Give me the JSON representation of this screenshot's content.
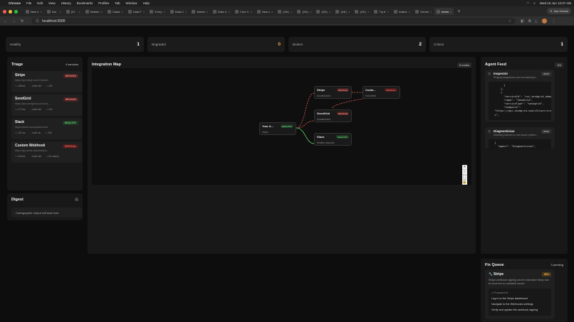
{
  "menubar": {
    "app": "Chrome",
    "items": [
      "File",
      "Edit",
      "View",
      "History",
      "Bookmarks",
      "Profiles",
      "Tab",
      "Window",
      "Help"
    ],
    "clock": "Wed 10 Jun 12:07 AM"
  },
  "tabs": [
    {
      "label": "New n"
    },
    {
      "label": "Dai"
    },
    {
      "label": "(21"
    },
    {
      "label": "Notebo"
    },
    {
      "label": "Claud"
    },
    {
      "label": "Data F"
    },
    {
      "label": "3 Key"
    },
    {
      "label": "Data C"
    },
    {
      "label": "Kimbo"
    },
    {
      "label": "Data C"
    },
    {
      "label": "Core C"
    },
    {
      "label": "New c"
    },
    {
      "label": "(24!)"
    },
    {
      "label": "(24!)"
    },
    {
      "label": "(24!)"
    },
    {
      "label": "(24!)"
    },
    {
      "label": "(24!)"
    },
    {
      "label": "Try fr"
    },
    {
      "label": "Author"
    },
    {
      "label": "Gemni"
    },
    {
      "label": "techn",
      "active": true
    }
  ],
  "ask_gemini": "Ask Gemini",
  "address": {
    "url": "localhost:3000"
  },
  "stats": [
    {
      "label": "Healthy",
      "value": "1"
    },
    {
      "label": "Degraded",
      "value": "0"
    },
    {
      "label": "Broken",
      "value": "2"
    },
    {
      "label": "Critical",
      "value": "1"
    }
  ],
  "triage": {
    "title": "Triage",
    "count": "4 services",
    "services": [
      {
        "name": "Stripe",
        "url": "https://api.stripe.com/v1/webh...",
        "latency": "183ms",
        "auth": "Auth fail",
        "code": "401",
        "status": "BROKEN"
      },
      {
        "name": "SendGrid",
        "url": "https://api.sendgrid.com/v3/us...",
        "latency": "177ms",
        "auth": "Auth fail",
        "code": "401",
        "status": "BROKEN"
      },
      {
        "name": "Slack",
        "url": "https://slack.com/api/auth.test",
        "latency": "187ms",
        "auth": "Auth ok",
        "code": "200",
        "status": "HEALTHY"
      },
      {
        "name": "Custom Webhook",
        "url": "https://api.acme.dev/webhoo...",
        "latency": "334ms",
        "auth": "Auth fail",
        "code": "No status",
        "status": "CRITICAL"
      }
    ]
  },
  "digest": {
    "title": "Digest",
    "body": "Cartographer output will land here."
  },
  "map": {
    "title": "Integration Map",
    "count": "5 nodes",
    "nodes": [
      {
        "name": "Your A...",
        "sub": "Origin",
        "status": "HEALTHY"
      },
      {
        "name": "Stripe",
        "sub": "Unauthorized",
        "status": "BROKEN"
      },
      {
        "name": "Custo...",
        "sub": "Host failed",
        "status": "CRITICAL"
      },
      {
        "name": "SendGrid",
        "sub": "Unauthorized",
        "status": "BROKEN"
      },
      {
        "name": "Slack",
        "sub": "Healthy response",
        "status": "HEALTHY"
      }
    ],
    "zoom": [
      "+",
      "−",
      "⛶",
      "🔒"
    ]
  },
  "feed": {
    "title": "Agent Feed",
    "count": "3/4",
    "agents": [
      {
        "name": "Inspector",
        "desc": "Pinging integrations and normalizing it...",
        "state": "done",
        "code": "        }\n      },\n      {\n        \"serviceId\": \"svc_sendgrid_demo\",\n        \"name\": \"SendGrid\",\n        \"serviceType\": \"sendgrid\",\n        \"endpoint\":\n  \"https://api.sendgrid.com/v3/user/credit\n  s\","
      },
      {
        "name": "Diagnostician",
        "desc": "Matching failures to root-cause pattern...",
        "state": "done",
        "code": "  {\n    \"agent\": \"Diagnostician\","
      }
    ]
  },
  "fixqueue": {
    "title": "Fix Queue",
    "count": "3 pending",
    "item": {
      "name": "Stripe",
      "confidence": "88%",
      "desc": "Stripe webhook signing secret mismatch likely due to incorrect or outdated secret",
      "proposed_label": "Proposed fix",
      "steps": [
        "Log in to the Stripe dashboard",
        "Navigate to the Webhooks settings",
        "Verify and update the webhook signing"
      ]
    }
  },
  "colors": {
    "healthy": "#6fd07a",
    "broken": "#f08a7a",
    "critical": "#ff6b5a",
    "degraded": "#f0a73e"
  }
}
